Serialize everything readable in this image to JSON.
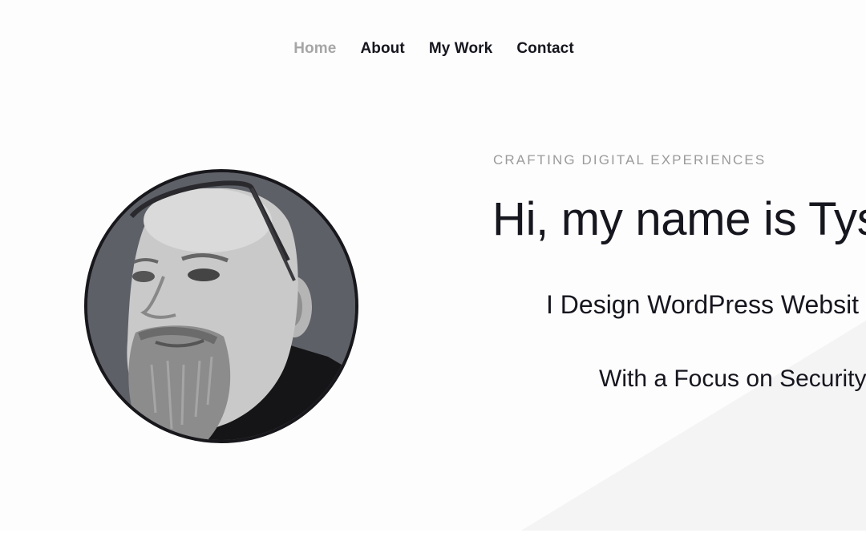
{
  "nav": {
    "items": [
      {
        "label": "Home",
        "active": true
      },
      {
        "label": "About",
        "active": false
      },
      {
        "label": "My Work",
        "active": false
      },
      {
        "label": "Contact",
        "active": false
      }
    ]
  },
  "hero": {
    "eyebrow": "CRAFTING DIGITAL EXPERIENCES",
    "headline": "Hi, my name is Tys",
    "subheading": "I Design WordPress Websit",
    "tagline": "With a Focus on Security a"
  },
  "colors": {
    "text": "#16161f",
    "muted": "#9b9b9b",
    "nav_active": "#a6a6a6",
    "background": "#fdfdfd"
  }
}
